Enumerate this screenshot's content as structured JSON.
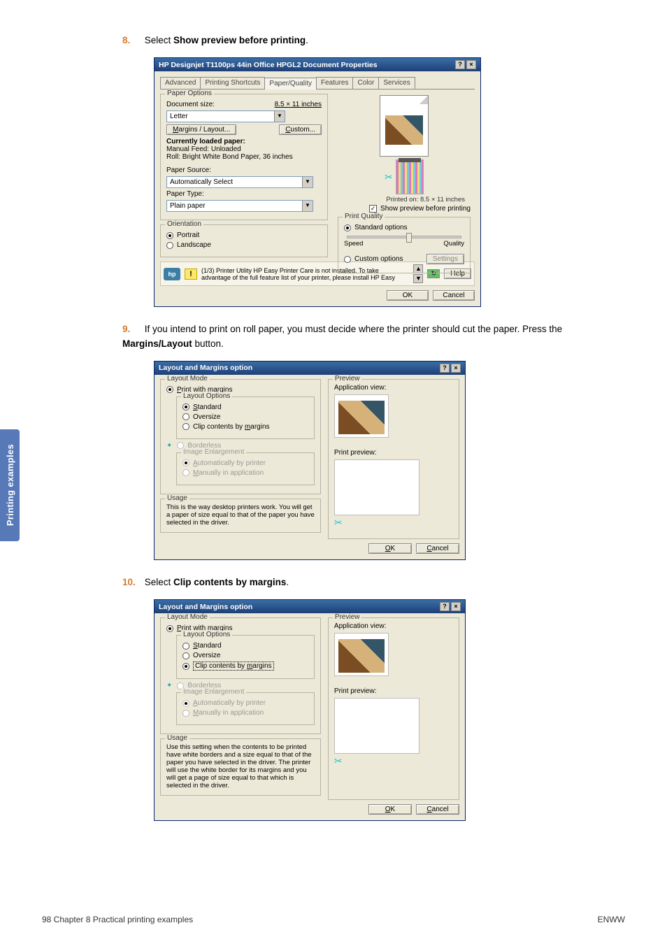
{
  "sidebar_tab": "Printing examples",
  "step8": {
    "num": "8.",
    "prefix": "Select ",
    "bold": "Show preview before printing",
    "suffix": "."
  },
  "step9": {
    "num": "9.",
    "text_a": "If you intend to print on roll paper, you must decide where the printer should cut the paper. Press the ",
    "bold": "Margins/Layout",
    "text_b": " button."
  },
  "step10": {
    "num": "10.",
    "prefix": "Select ",
    "bold": "Clip contents by margins",
    "suffix": "."
  },
  "footer": {
    "left": "98    Chapter 8   Practical printing examples",
    "right": "ENWW"
  },
  "dlg1": {
    "title": "HP Designjet T1100ps 44in Office HPGL2 Document Properties",
    "tabs": [
      "Advanced",
      "Printing Shortcuts",
      "Paper/Quality",
      "Features",
      "Color",
      "Services"
    ],
    "paper_options_legend": "Paper Options",
    "doc_size_label": "Document size:",
    "doc_size_value": "8.5 × 11 inches",
    "doc_size_combo": "Letter",
    "margins_btn": "Margins / Layout...",
    "custom_btn": "Custom...",
    "currently_loaded": "Currently loaded paper:",
    "manual_feed": "Manual Feed: Unloaded",
    "roll_info": "Roll:  Bright White Bond Paper, 36 inches",
    "paper_source_label": "Paper Source:",
    "paper_source_value": "Automatically Select",
    "paper_type_label": "Paper Type:",
    "paper_type_value": "Plain paper",
    "orientation_legend": "Orientation",
    "portrait": "Portrait",
    "landscape": "Landscape",
    "printed_on": "Printed on: 8.5 × 11 inches",
    "show_preview": "Show preview before printing",
    "print_quality_legend": "Print Quality",
    "std_options": "Standard options",
    "speed": "Speed",
    "quality": "Quality",
    "custom_options": "Custom options",
    "settings": "Settings",
    "hp_badge": "hp",
    "warn_text": "(1/3) Printer Utility HP Easy Printer Care is not installed.  To take advantage of the full feature list of your printer, please install HP Easy",
    "help": "Help",
    "ok": "OK",
    "cancel": "Cancel"
  },
  "dlg2": {
    "title": "Layout and Margins option",
    "layout_mode": "Layout Mode",
    "print_with_margins": "Print with margins",
    "layout_options": "Layout Options",
    "standard": "Standard",
    "oversize": "Oversize",
    "clip_contents": "Clip contents by margins",
    "borderless": "Borderless",
    "image_enlargement": "Image Enlargement",
    "auto_by_printer": "Automatically by printer",
    "manual_in_app": "Manually in application",
    "usage_legend": "Usage",
    "usage_text": "This is the way desktop printers work. You will get a paper of size equal to that of the paper you have selected in the driver.",
    "preview_legend": "Preview",
    "app_view": "Application view:",
    "print_preview": "Print preview:",
    "ok": "OK",
    "cancel": "Cancel"
  },
  "dlg3": {
    "title": "Layout and Margins option",
    "layout_mode": "Layout Mode",
    "print_with_margins": "Print with margins",
    "layout_options": "Layout Options",
    "standard": "Standard",
    "oversize": "Oversize",
    "clip_contents": "Clip contents by margins",
    "borderless": "Borderless",
    "image_enlargement": "Image Enlargement",
    "auto_by_printer": "Automatically by printer",
    "manual_in_app": "Manually in application",
    "usage_legend": "Usage",
    "usage_text": "Use this setting when the contents to be printed have white borders and a size equal to that of the paper you have selected in the driver. The printer will use the white border for its margins and you will get a page of size equal to that which is selected in the driver.",
    "preview_legend": "Preview",
    "app_view": "Application view:",
    "print_preview": "Print preview:",
    "ok": "OK",
    "cancel": "Cancel"
  }
}
